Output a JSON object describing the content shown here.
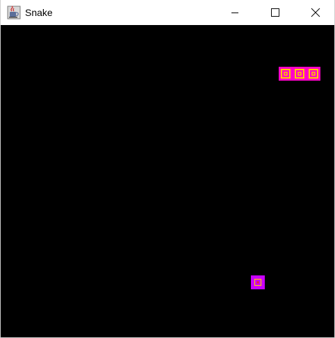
{
  "window": {
    "title": "Snake",
    "icon": "java-cup-icon",
    "controls": {
      "minimize_icon": "minimize-icon",
      "maximize_icon": "maximize-icon",
      "close_icon": "close-icon"
    }
  },
  "game": {
    "background_color": "#000000",
    "snake": {
      "color": "#ff00c8",
      "ring_color": "#ffc800",
      "segment_count": 3
    },
    "food": {
      "color": "#c800ff",
      "ring_color": "#ffc800"
    }
  }
}
